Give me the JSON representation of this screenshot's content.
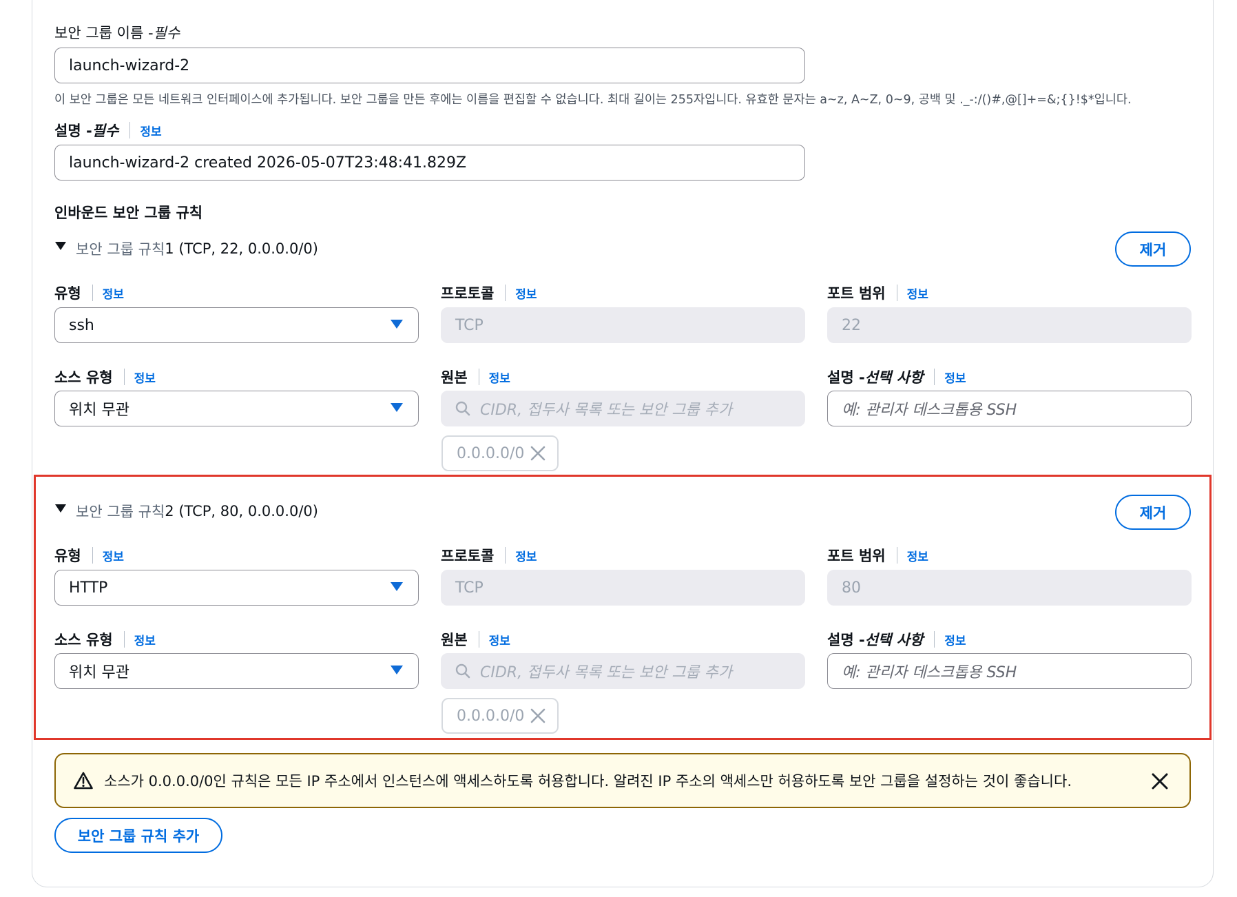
{
  "name_field": {
    "label": "보안 그룹 이름 - ",
    "label_emph": "필수",
    "value": "launch-wizard-2",
    "hint": "이 보안 그룹은 모든 네트워크 인터페이스에 추가됩니다. 보안 그룹을 만든 후에는 이름을 편집할 수 없습니다. 최대 길이는 255자입니다. 유효한 문자는 a~z, A~Z, 0~9, 공백 및 ._-:/()#,@[]+=&;{}!$*입니다."
  },
  "description_field": {
    "label": "설명 - ",
    "label_emph": "필수",
    "info": "정보",
    "value": "launch-wizard-2 created 2026-05-07T23:48:41.829Z"
  },
  "inbound": {
    "title": "인바운드 보안 그룹 규칙",
    "rules": [
      {
        "header_prefix": "보안 그룹 규칙 ",
        "header_suffix": "1 (TCP, 22, 0.0.0.0/0)",
        "remove_label": "제거",
        "type_label": "유형",
        "type_info": "정보",
        "type_value": "ssh",
        "protocol_label": "프로토콜",
        "protocol_info": "정보",
        "protocol_value": "TCP",
        "port_label": "포트 범위",
        "port_info": "정보",
        "port_value": "22",
        "source_type_label": "소스 유형",
        "source_type_info": "정보",
        "source_type_value": "위치 무관",
        "source_label": "원본",
        "source_info": "정보",
        "source_placeholder": "CIDR, 접두사 목록 또는 보안 그룹 추가",
        "source_token": "0.0.0.0/0",
        "desc_label": "설명 - ",
        "desc_label_emph": "선택 사항",
        "desc_info": "정보",
        "desc_placeholder": "예: 관리자 데스크톱용 SSH"
      },
      {
        "header_prefix": "보안 그룹 규칙 ",
        "header_suffix": "2 (TCP, 80, 0.0.0.0/0)",
        "remove_label": "제거",
        "type_label": "유형",
        "type_info": "정보",
        "type_value": "HTTP",
        "protocol_label": "프로토콜",
        "protocol_info": "정보",
        "protocol_value": "TCP",
        "port_label": "포트 범위",
        "port_info": "정보",
        "port_value": "80",
        "source_type_label": "소스 유형",
        "source_type_info": "정보",
        "source_type_value": "위치 무관",
        "source_label": "원본",
        "source_info": "정보",
        "source_placeholder": "CIDR, 접두사 목록 또는 보안 그룹 추가",
        "source_token": "0.0.0.0/0",
        "desc_label": "설명 - ",
        "desc_label_emph": "선택 사항",
        "desc_info": "정보",
        "desc_placeholder": "예: 관리자 데스크톱용 SSH"
      }
    ]
  },
  "warning": {
    "text": "소스가 0.0.0.0/0인 규칙은 모든 IP 주소에서 인스턴스에 액세스하도록 허용합니다. 알려진 IP 주소의 액세스만 허용하도록 보안 그룹을 설정하는 것이 좋습니다."
  },
  "add_rule_button": "보안 그룹 규칙 추가",
  "colors": {
    "link": "#006ce0",
    "highlight_border": "#e0372b",
    "warning_border": "#8d6605",
    "warning_bg": "#fffce9"
  }
}
